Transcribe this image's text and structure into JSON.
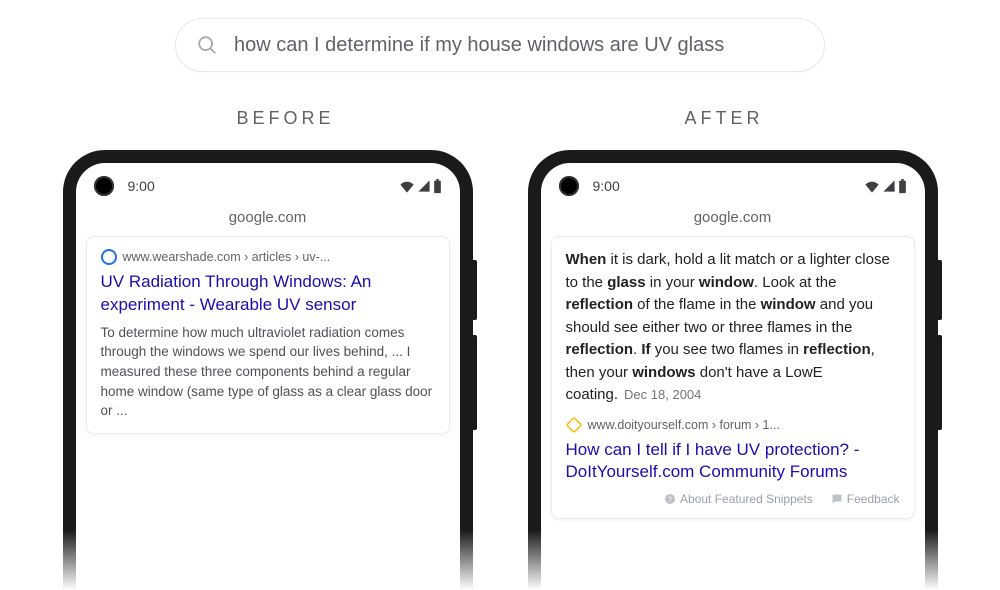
{
  "search": {
    "query": "how can I determine if my house windows are UV glass"
  },
  "labels": {
    "before": "BEFORE",
    "after": "AFTER"
  },
  "status": {
    "time": "9:00"
  },
  "domain": "google.com",
  "before": {
    "breadcrumb": "www.wearshade.com › articles › uv-...",
    "title": "UV Radiation Through Windows: An experiment - Wearable UV sensor",
    "snippet": "To determine how much ultraviolet radiation comes through the windows we spend our lives behind, ... I measured these three components behind a regular home window (same type of glass as a clear glass door or  ..."
  },
  "after": {
    "featured_parts": [
      {
        "t": "When",
        "b": true
      },
      {
        "t": " it is dark, hold a lit match or a lighter close to the "
      },
      {
        "t": "glass",
        "b": true
      },
      {
        "t": " in your "
      },
      {
        "t": "window",
        "b": true
      },
      {
        "t": ". Look at the "
      },
      {
        "t": "reflection",
        "b": true
      },
      {
        "t": " of the flame in the "
      },
      {
        "t": "window",
        "b": true
      },
      {
        "t": " and you should see either two or three flames in the "
      },
      {
        "t": "reflection",
        "b": true
      },
      {
        "t": ". "
      },
      {
        "t": "If",
        "b": true
      },
      {
        "t": " you see two flames in "
      },
      {
        "t": "reflection",
        "b": true
      },
      {
        "t": ", then your "
      },
      {
        "t": "windows",
        "b": true
      },
      {
        "t": " don't have a LowE coating."
      }
    ],
    "date": "Dec 18, 2004",
    "breadcrumb": "www.doityourself.com › forum › 1...",
    "title": "How can I tell if I have UV protection? - DoItYourself.com Community Forums",
    "about": "About Featured Snippets",
    "feedback": "Feedback"
  }
}
